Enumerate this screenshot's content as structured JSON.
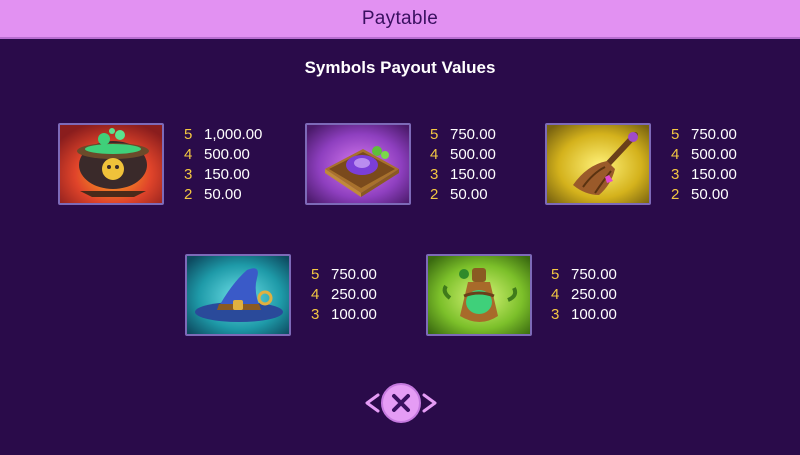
{
  "header": {
    "title": "Paytable"
  },
  "section_title": "Symbols Payout Values",
  "symbols": [
    {
      "name": "cauldron",
      "tile_color": "#c0392b",
      "pays": [
        {
          "count": "5",
          "value": "1,000.00"
        },
        {
          "count": "4",
          "value": "500.00"
        },
        {
          "count": "3",
          "value": "150.00"
        },
        {
          "count": "2",
          "value": "50.00"
        }
      ]
    },
    {
      "name": "spellbook",
      "tile_color": "#8e3fbf",
      "pays": [
        {
          "count": "5",
          "value": "750.00"
        },
        {
          "count": "4",
          "value": "500.00"
        },
        {
          "count": "3",
          "value": "150.00"
        },
        {
          "count": "2",
          "value": "50.00"
        }
      ]
    },
    {
      "name": "broomstick",
      "tile_color": "#d4b21c",
      "pays": [
        {
          "count": "5",
          "value": "750.00"
        },
        {
          "count": "4",
          "value": "500.00"
        },
        {
          "count": "3",
          "value": "150.00"
        },
        {
          "count": "2",
          "value": "50.00"
        }
      ]
    },
    {
      "name": "witch-hat",
      "tile_color": "#1e9aa8",
      "pays": [
        {
          "count": "5",
          "value": "750.00"
        },
        {
          "count": "4",
          "value": "250.00"
        },
        {
          "count": "3",
          "value": "100.00"
        }
      ]
    },
    {
      "name": "potion-bottle",
      "tile_color": "#7cc02a",
      "pays": [
        {
          "count": "5",
          "value": "750.00"
        },
        {
          "count": "4",
          "value": "250.00"
        },
        {
          "count": "3",
          "value": "100.00"
        }
      ]
    }
  ],
  "icons": {
    "close": "close-icon",
    "prev": "chevron-left-icon",
    "next": "chevron-right-icon"
  }
}
